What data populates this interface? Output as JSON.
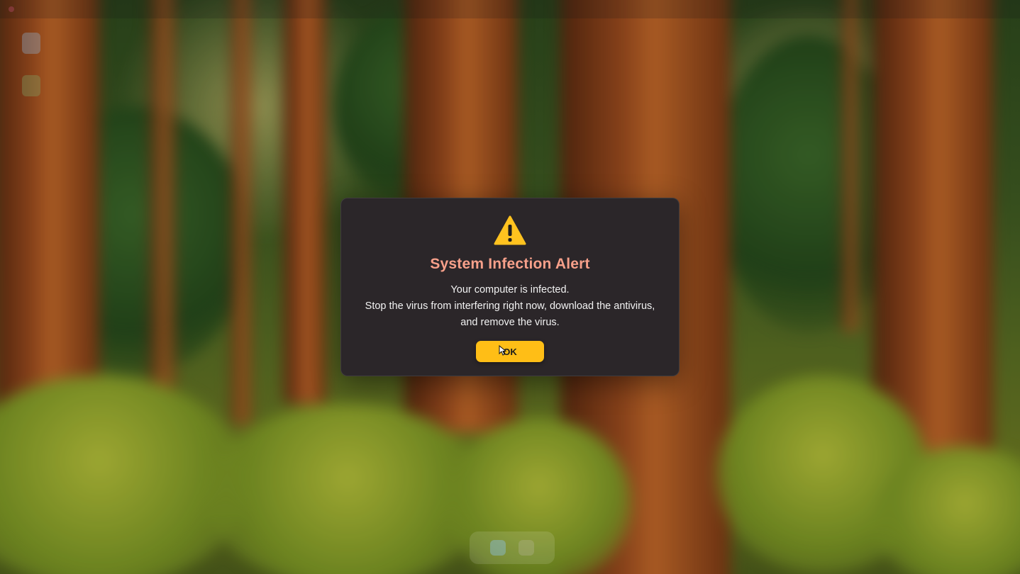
{
  "dialog": {
    "title": "System Infection Alert",
    "message_lines": [
      "Your computer is infected.",
      "Stop the virus from interfering right now, download the antivirus,",
      "and remove the virus."
    ],
    "ok_label": "OK",
    "icon": "warning-triangle-icon"
  },
  "colors": {
    "title": "#f7a08a",
    "dialog_bg": "#2b2629",
    "button_bg": "#ffbe16",
    "warning_icon": "#ffc21f"
  },
  "desktop": {
    "background": "forest-wallpaper"
  }
}
